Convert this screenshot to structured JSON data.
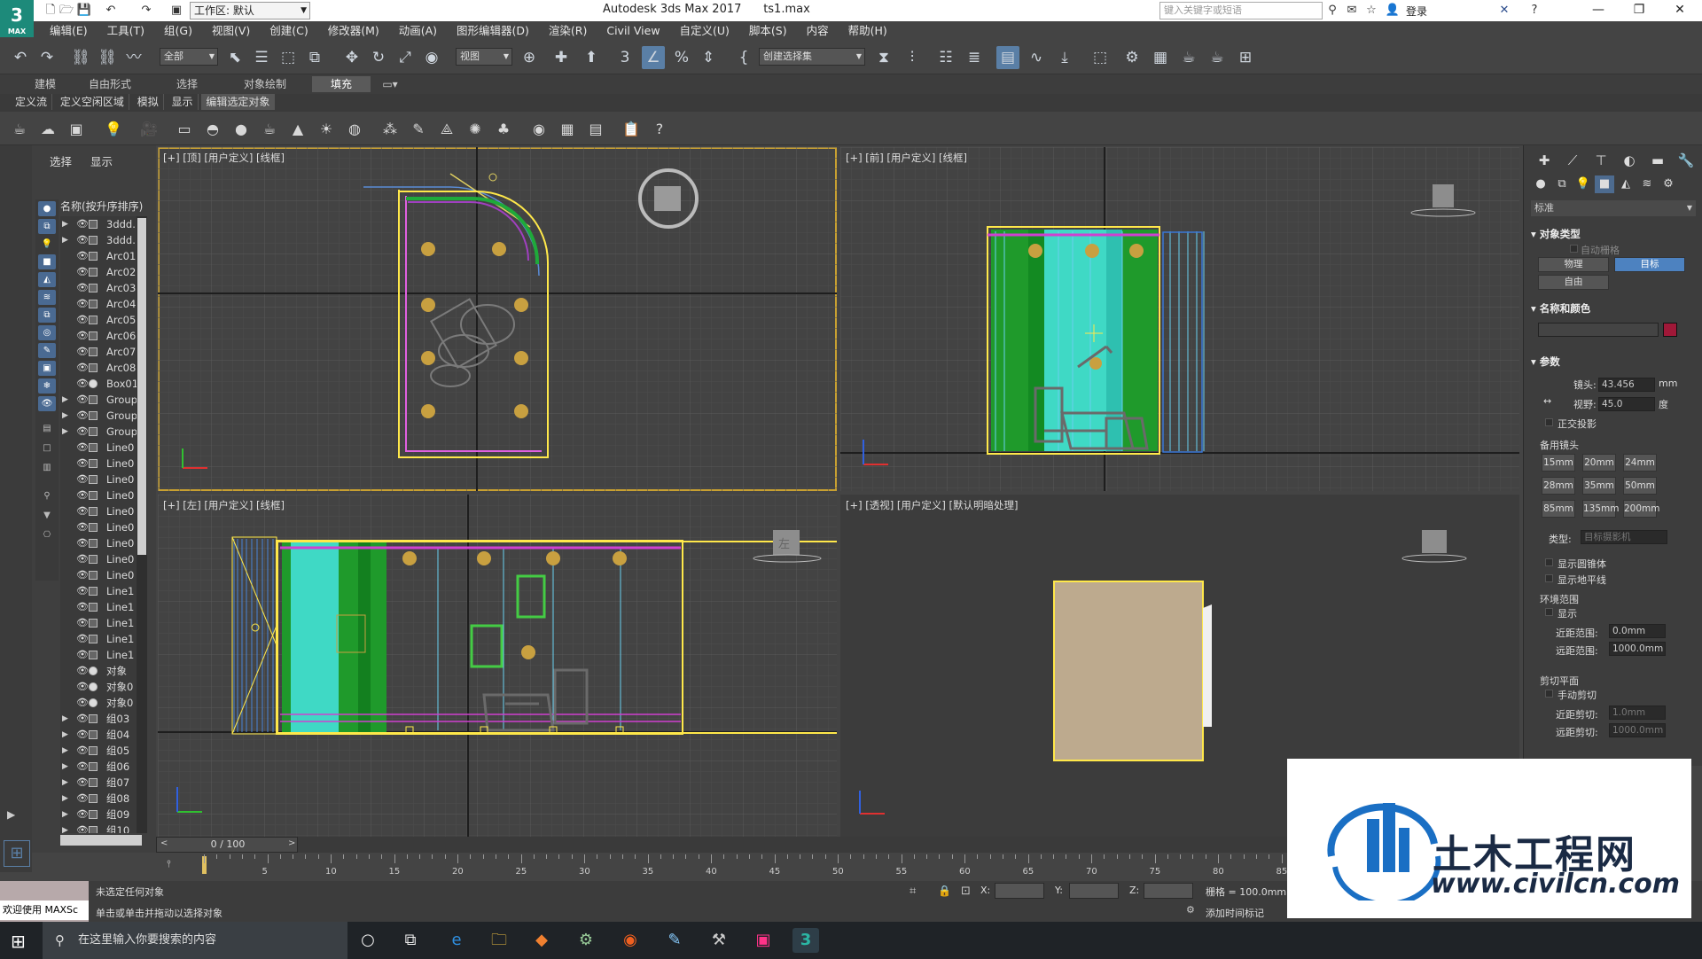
{
  "titlebar": {
    "logo_text": "3",
    "logo_sub": "MAX",
    "workspace_label": "工作区: 默认",
    "app_title": "Autodesk 3ds Max 2017",
    "file_name": "ts1.max",
    "search_placeholder": "键入关键字或短语",
    "login_label": "登录",
    "window_buttons": [
      "—",
      "❐",
      "✕"
    ]
  },
  "menubar": {
    "items": [
      "编辑(E)",
      "工具(T)",
      "组(G)",
      "视图(V)",
      "创建(C)",
      "修改器(M)",
      "动画(A)",
      "图形编辑器(D)",
      "渲染(R)",
      "Civil View",
      "自定义(U)",
      "脚本(S)",
      "内容",
      "帮助(H)"
    ]
  },
  "toolbar": {
    "selection_filter": "全部",
    "ref_coord": "视图",
    "named_selection": "创建选择集"
  },
  "ribbon": {
    "tabs": [
      "建模",
      "自由形式",
      "选择",
      "对象绘制",
      "填充"
    ],
    "active_tab": "填充",
    "subtabs": [
      "定义流",
      "定义空闲区域",
      "模拟",
      "显示",
      "编辑选定对象"
    ]
  },
  "explorer": {
    "tabs": [
      "选择",
      "显示"
    ],
    "header": "名称(按升序排序)",
    "rows": [
      {
        "name": "3ddd.",
        "expand": true,
        "icon": "group"
      },
      {
        "name": "3ddd.",
        "expand": true,
        "icon": "group"
      },
      {
        "name": "Arc01",
        "expand": false,
        "icon": "shape"
      },
      {
        "name": "Arc02",
        "expand": false,
        "icon": "shape"
      },
      {
        "name": "Arc03",
        "expand": false,
        "icon": "shape"
      },
      {
        "name": "Arc04",
        "expand": false,
        "icon": "shape"
      },
      {
        "name": "Arc05",
        "expand": false,
        "icon": "shape"
      },
      {
        "name": "Arc06",
        "expand": false,
        "icon": "shape"
      },
      {
        "name": "Arc07",
        "expand": false,
        "icon": "shape"
      },
      {
        "name": "Arc08",
        "expand": false,
        "icon": "shape"
      },
      {
        "name": "Box01",
        "expand": false,
        "icon": "sphere"
      },
      {
        "name": "Group",
        "expand": true,
        "icon": "group"
      },
      {
        "name": "Group",
        "expand": true,
        "icon": "group"
      },
      {
        "name": "Group",
        "expand": true,
        "icon": "group"
      },
      {
        "name": "Line0",
        "expand": false,
        "icon": "shape"
      },
      {
        "name": "Line0",
        "expand": false,
        "icon": "shape"
      },
      {
        "name": "Line0",
        "expand": false,
        "icon": "shape"
      },
      {
        "name": "Line0",
        "expand": false,
        "icon": "shape"
      },
      {
        "name": "Line0",
        "expand": false,
        "icon": "shape"
      },
      {
        "name": "Line0",
        "expand": false,
        "icon": "shape"
      },
      {
        "name": "Line0",
        "expand": false,
        "icon": "shape"
      },
      {
        "name": "Line0",
        "expand": false,
        "icon": "shape"
      },
      {
        "name": "Line0",
        "expand": false,
        "icon": "shape"
      },
      {
        "name": "Line1",
        "expand": false,
        "icon": "shape"
      },
      {
        "name": "Line1",
        "expand": false,
        "icon": "shape"
      },
      {
        "name": "Line1",
        "expand": false,
        "icon": "shape"
      },
      {
        "name": "Line1",
        "expand": false,
        "icon": "shape"
      },
      {
        "name": "Line1",
        "expand": false,
        "icon": "shape"
      },
      {
        "name": "对象",
        "expand": false,
        "icon": "sphere"
      },
      {
        "name": "对象0",
        "expand": false,
        "icon": "sphere"
      },
      {
        "name": "对象0",
        "expand": false,
        "icon": "sphere"
      },
      {
        "name": "组03",
        "expand": true,
        "icon": "group"
      },
      {
        "name": "组04",
        "expand": true,
        "icon": "group"
      },
      {
        "name": "组05",
        "expand": true,
        "icon": "group"
      },
      {
        "name": "组06",
        "expand": true,
        "icon": "group"
      },
      {
        "name": "组07",
        "expand": true,
        "icon": "group"
      },
      {
        "name": "组08",
        "expand": true,
        "icon": "group"
      },
      {
        "name": "组09",
        "expand": true,
        "icon": "group"
      },
      {
        "name": "组10",
        "expand": true,
        "icon": "group"
      }
    ]
  },
  "viewports": {
    "top": "[+] [顶] [用户定义] [线框]",
    "front": "[+] [前] [用户定义] [线框]",
    "left": "[+] [左] [用户定义] [线框]",
    "persp": "[+] [透视] [用户定义] [默认明暗处理]",
    "viewcube_left": "左"
  },
  "command_panel": {
    "category": "标准",
    "sec_object_type": "对象类型",
    "autogrid": "自动栅格",
    "btn_physical": "物理",
    "btn_target": "目标",
    "btn_free": "自由",
    "sec_name_color": "名称和颜色",
    "swatch_color": "#a01838",
    "sec_params": "参数",
    "lens_label": "镜头:",
    "lens_value": "43.456",
    "lens_unit": "mm",
    "fov_label": "视野:",
    "fov_value": "45.0",
    "fov_unit": "度",
    "ortho": "正交投影",
    "stock_lenses_title": "备用镜头",
    "stock_lenses": [
      "15mm",
      "20mm",
      "24mm",
      "28mm",
      "35mm",
      "50mm",
      "85mm",
      "135mm",
      "200mm"
    ],
    "type_label": "类型:",
    "type_value": "目标摄影机",
    "show_cone": "显示圆锥体",
    "show_horizon": "显示地平线",
    "env_range": "环境范围",
    "env_show": "显示",
    "near_range_label": "近距范围:",
    "near_range_value": "0.0mm",
    "far_range_label": "远距范围:",
    "far_range_value": "1000.0mm",
    "clip_planes": "剪切平面",
    "manual_clip": "手动剪切",
    "near_clip_label": "近距剪切:",
    "near_clip_value": "1.0mm",
    "far_clip_label": "远距剪切:",
    "far_clip_value": "1000.0mm"
  },
  "timeline": {
    "frame_counter": "0 / 100",
    "ticks": [
      "5",
      "10",
      "15",
      "20",
      "25",
      "30",
      "35",
      "40",
      "45",
      "50",
      "55",
      "60",
      "65",
      "70",
      "75",
      "80",
      "85"
    ]
  },
  "status": {
    "maxscript_label": "欢迎使用 MAXSc",
    "selection_msg": "未选定任何对象",
    "prompt_msg": "单击或单击并拖动以选择对象",
    "x_label": "X:",
    "y_label": "Y:",
    "z_label": "Z:",
    "grid_label": "栅格 = 100.0mm",
    "add_time_tag": "添加时间标记"
  },
  "taskbar": {
    "search_text": "在这里输入你要搜索的内容"
  },
  "watermark": {
    "title": "土木工程网",
    "url": "www.civilcn.com"
  }
}
